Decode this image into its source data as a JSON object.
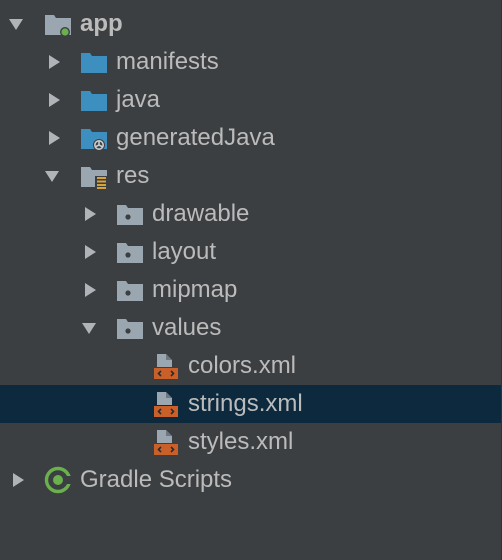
{
  "colors": {
    "background": "#3c3f41",
    "text": "#bbbbbb",
    "selection": "#0d293e",
    "folder_blue": "#3d8fbf",
    "folder_gray": "#9aa7b0",
    "xml_orange": "#c9602a",
    "gradle_green": "#6ab04c"
  },
  "tree": {
    "app": {
      "label": "app",
      "expanded": true,
      "icon": "module-folder-icon"
    },
    "manifests": {
      "label": "manifests",
      "expanded": false,
      "icon": "folder-blue-icon"
    },
    "java": {
      "label": "java",
      "expanded": false,
      "icon": "folder-blue-icon"
    },
    "generatedJava": {
      "label": "generatedJava",
      "expanded": false,
      "icon": "generated-folder-icon"
    },
    "res": {
      "label": "res",
      "expanded": true,
      "icon": "resources-folder-icon"
    },
    "drawable": {
      "label": "drawable",
      "expanded": false,
      "icon": "folder-gray-icon"
    },
    "layout": {
      "label": "layout",
      "expanded": false,
      "icon": "folder-gray-icon"
    },
    "mipmap": {
      "label": "mipmap",
      "expanded": false,
      "icon": "folder-gray-icon"
    },
    "values": {
      "label": "values",
      "expanded": true,
      "icon": "folder-gray-icon"
    },
    "colors": {
      "label": "colors.xml",
      "icon": "xml-file-icon"
    },
    "strings": {
      "label": "strings.xml",
      "icon": "xml-file-icon",
      "selected": true
    },
    "styles": {
      "label": "styles.xml",
      "icon": "xml-file-icon"
    },
    "gradle": {
      "label": "Gradle Scripts",
      "expanded": false,
      "icon": "gradle-icon"
    }
  }
}
